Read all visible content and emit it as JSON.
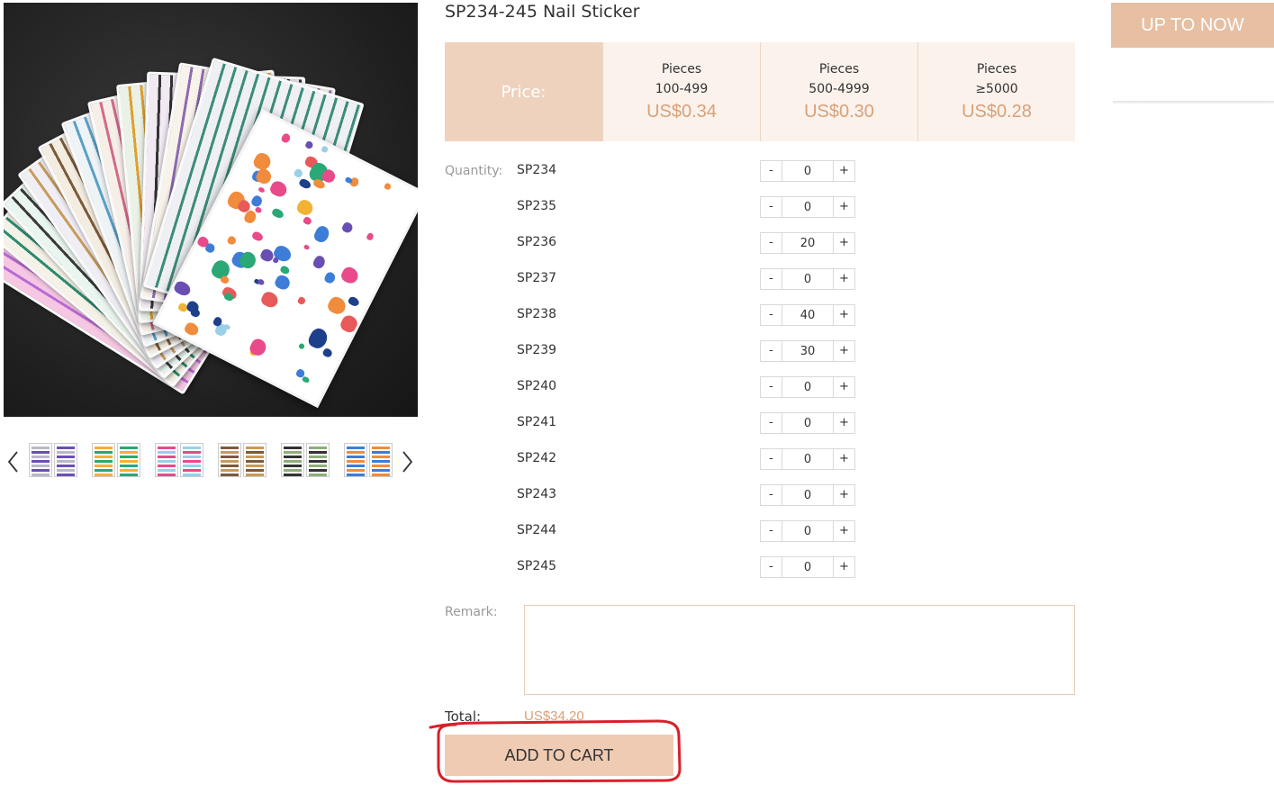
{
  "product": {
    "title": "SP234-245 Nail Sticker"
  },
  "price_table": {
    "label": "Price:",
    "tiers": [
      {
        "pieces": "Pieces",
        "range": "100-499",
        "price": "US$0.34"
      },
      {
        "pieces": "Pieces",
        "range": "500-4999",
        "price": "US$0.30"
      },
      {
        "pieces": "Pieces",
        "range": "≥5000",
        "price": "US$0.28"
      }
    ]
  },
  "quantity": {
    "label": "Quantity:",
    "minus": "-",
    "plus": "+",
    "rows": [
      {
        "sku": "SP234",
        "value": "0"
      },
      {
        "sku": "SP235",
        "value": "0"
      },
      {
        "sku": "SP236",
        "value": "20"
      },
      {
        "sku": "SP237",
        "value": "0"
      },
      {
        "sku": "SP238",
        "value": "40"
      },
      {
        "sku": "SP239",
        "value": "30"
      },
      {
        "sku": "SP240",
        "value": "0"
      },
      {
        "sku": "SP241",
        "value": "0"
      },
      {
        "sku": "SP242",
        "value": "0"
      },
      {
        "sku": "SP243",
        "value": "0"
      },
      {
        "sku": "SP244",
        "value": "0"
      },
      {
        "sku": "SP245",
        "value": "0"
      }
    ]
  },
  "remark": {
    "label": "Remark:",
    "value": ""
  },
  "total": {
    "label": "Total:",
    "value": "US$34.20"
  },
  "cart": {
    "label": "ADD TO CART"
  },
  "side": {
    "up_label": "UP TO NOW"
  },
  "gallery": {
    "thumb_count": 6
  },
  "colors": {
    "accent": "#efd2bd",
    "price_text": "#d9a078",
    "highlight": "#d9202a"
  }
}
